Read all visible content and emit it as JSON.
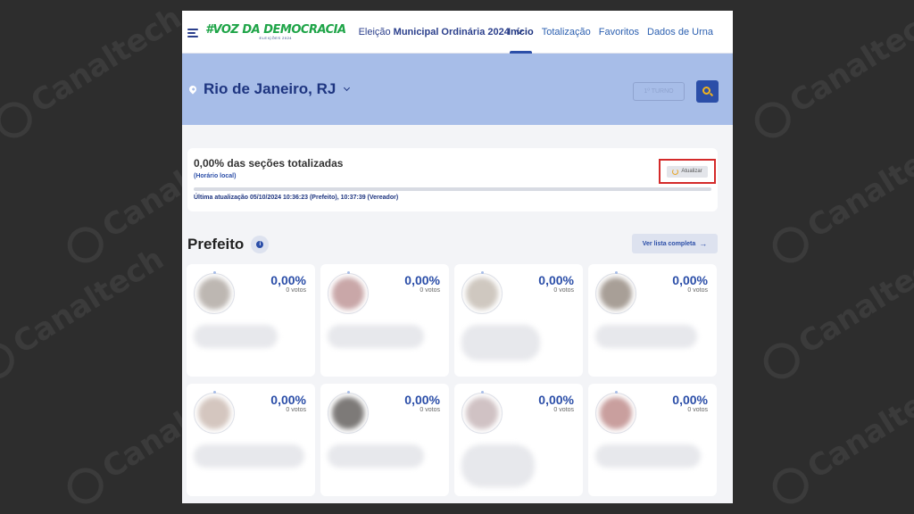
{
  "watermark": "Canaltech",
  "header": {
    "logo_main": "#VOZ DA DEMOCRACIA",
    "logo_sub": "ELEIÇÕES 2024",
    "election_prefix": "Eleição",
    "election_name": "Municipal Ordinária 2024",
    "nav": [
      "Início",
      "Totalização",
      "Favoritos",
      "Dados de Urna"
    ],
    "active_nav": "Início"
  },
  "location": {
    "city": "Rio de Janeiro, RJ",
    "turno": "1º TURNO"
  },
  "status": {
    "title": "0,00% das seções totalizadas",
    "local_time": "(Horário local)",
    "progress": 0,
    "last_update": "Última atualização 05/10/2024 10:36:23 (Prefeito), 10:37:39 (Vereador)",
    "refresh_label": "Atualizar"
  },
  "section": {
    "title": "Prefeito",
    "see_all": "Ver lista completa"
  },
  "candidates": [
    {
      "percent": "0,00%",
      "votes": "0 votos",
      "face": "#bdb7b2"
    },
    {
      "percent": "0,00%",
      "votes": "0 votos",
      "face": "#c9a7a8"
    },
    {
      "percent": "0,00%",
      "votes": "0 votos",
      "face": "#cfc8c0"
    },
    {
      "percent": "0,00%",
      "votes": "0 votos",
      "face": "#a89f97"
    },
    {
      "percent": "0,00%",
      "votes": "0 votos",
      "face": "#d4c6bf"
    },
    {
      "percent": "0,00%",
      "votes": "0 votos",
      "face": "#7d7a78"
    },
    {
      "percent": "0,00%",
      "votes": "0 votos",
      "face": "#d0c2c4"
    },
    {
      "percent": "0,00%",
      "votes": "0 votos",
      "face": "#c99f9e"
    }
  ]
}
